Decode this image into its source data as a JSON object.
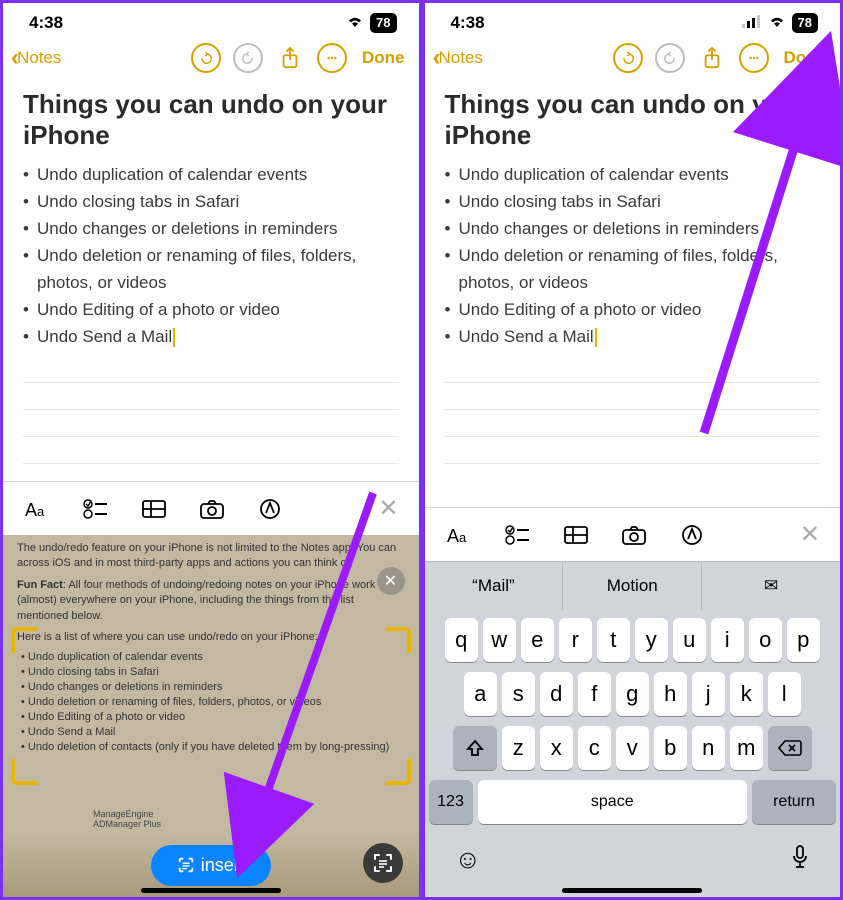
{
  "status": {
    "time": "4:38",
    "battery": "78"
  },
  "nav": {
    "back": "Notes",
    "done": "Done"
  },
  "note": {
    "title": "Things you can undo on your iPhone",
    "bullets": [
      "Undo duplication of calendar events",
      "Undo closing tabs in Safari",
      "Undo changes or deletions in reminders",
      "Undo deletion or renaming of files, folders, photos, or videos",
      "Undo Editing of a photo or video",
      "Undo Send a Mail"
    ]
  },
  "camera": {
    "intro": "The undo/redo feature on your iPhone is not limited to the Notes app. You can across iOS and in most third-party apps and actions you can think of.",
    "funfact_label": "Fun Fact",
    "funfact": ": All four methods of undoing/redoing notes on your iPhone work (almost) everywhere on your iPhone, including the things from the list mentioned below.",
    "listintro": "Here is a list of where you can use undo/redo on your iPhone:",
    "list": [
      "Undo duplication of calendar events",
      "Undo closing tabs in Safari",
      "Undo changes or deletions in reminders",
      "Undo deletion or renaming of files, folders, photos, or videos",
      "Undo Editing of a photo or video",
      "Undo Send a Mail",
      "Undo deletion of contacts (only if you have deleted them by long-pressing)"
    ],
    "insert": "insert",
    "brand1": "ManageEngine",
    "brand2": "ADManager Plus"
  },
  "keyboard": {
    "pred1": "Mail",
    "pred2": "Motion",
    "row1": [
      "q",
      "w",
      "e",
      "r",
      "t",
      "y",
      "u",
      "i",
      "o",
      "p"
    ],
    "row2": [
      "a",
      "s",
      "d",
      "f",
      "g",
      "h",
      "j",
      "k",
      "l"
    ],
    "row3": [
      "z",
      "x",
      "c",
      "v",
      "b",
      "n",
      "m"
    ],
    "numkey": "123",
    "space": "space",
    "return": "return"
  }
}
